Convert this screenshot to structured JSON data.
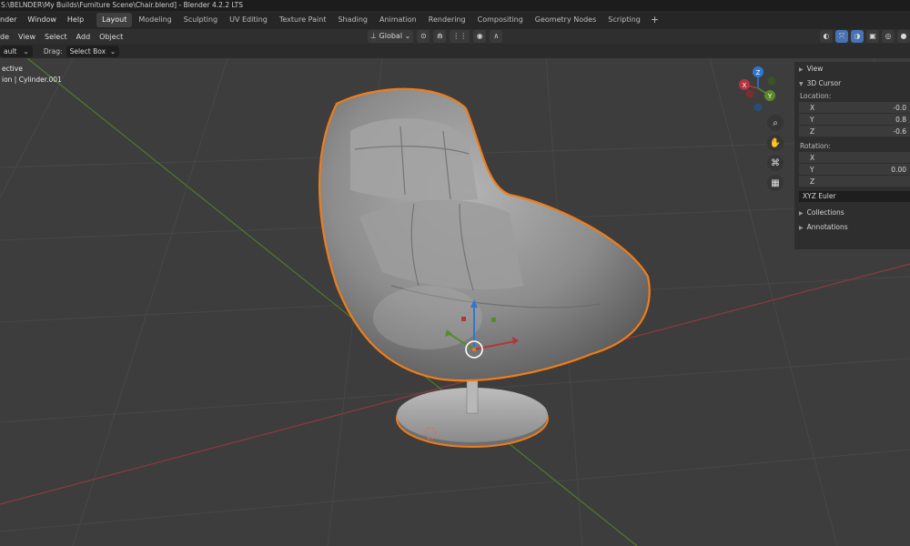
{
  "titlebar": {
    "text": "S:\\BELNDER\\My Builds\\Furniture Scene\\Chair.blend] - Blender 4.2.2 LTS"
  },
  "menubar": {
    "menus": [
      "nder",
      "Window",
      "Help"
    ],
    "tabs": [
      "Layout",
      "Modeling",
      "Sculpting",
      "UV Editing",
      "Texture Paint",
      "Shading",
      "Animation",
      "Rendering",
      "Compositing",
      "Geometry Nodes",
      "Scripting"
    ],
    "active_tab": "Layout",
    "add_tab": "+"
  },
  "header": {
    "mode": "de",
    "menus": [
      "View",
      "Select",
      "Add",
      "Object"
    ],
    "orientation": "Global"
  },
  "toolsettings": {
    "transform_value": "ault",
    "drag_label": "Drag:",
    "drag_value": "Select Box"
  },
  "viewport": {
    "view_name": "ective",
    "object_info": "ion | Cylinder.001"
  },
  "npanel": {
    "view_label": "View",
    "cursor_label": "3D Cursor",
    "location_label": "Location:",
    "location": [
      {
        "axis": "X",
        "value": "-0.0"
      },
      {
        "axis": "Y",
        "value": "0.8"
      },
      {
        "axis": "Z",
        "value": "-0.6"
      }
    ],
    "rotation_label": "Rotation:",
    "rotation": [
      {
        "axis": "X",
        "value": ""
      },
      {
        "axis": "Y",
        "value": "0.00"
      },
      {
        "axis": "Z",
        "value": ""
      }
    ],
    "rotation_mode": "XYZ Euler",
    "collections_label": "Collections",
    "annotations_label": "Annotations"
  },
  "gizmo": {
    "x_label": "X",
    "y_label": "Y",
    "z_label": "Z"
  },
  "colors": {
    "selection_outline": "#f07d19",
    "axis_x": "#b6343e",
    "axis_y": "#5a8a2a",
    "axis_z": "#2f77d0",
    "active_tab_bg": "#3f3f3f",
    "viewport_bg": "#3d3d3d"
  },
  "icons": [
    "zoom-icon",
    "hand-pan-icon",
    "camera-icon",
    "grid-icon",
    "chevron-right-icon",
    "cursor-icon"
  ]
}
